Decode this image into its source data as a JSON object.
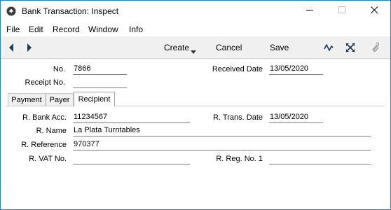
{
  "window": {
    "title": "Bank Transaction: Inspect"
  },
  "menu": {
    "items": [
      "File",
      "Edit",
      "Record",
      "Window",
      "Info"
    ]
  },
  "toolbar": {
    "create_label": "Create",
    "cancel_label": "Cancel",
    "save_label": "Save"
  },
  "header": {
    "no_label": "No.",
    "no_value": "7866",
    "received_date_label": "Received Date",
    "received_date_value": "13/05/2020",
    "receipt_no_label": "Receipt No.",
    "receipt_no_value": ""
  },
  "tabs": [
    {
      "label": "Payment",
      "active": false
    },
    {
      "label": "Payer",
      "active": false
    },
    {
      "label": "Recipient",
      "active": true
    }
  ],
  "recipient": {
    "bank_acc_label": "R. Bank Acc.",
    "bank_acc_value": "11234567",
    "trans_date_label": "R. Trans. Date",
    "trans_date_value": "13/05/2020",
    "name_label": "R. Name",
    "name_value": "La Plata Turntables",
    "reference_label": "R. Reference",
    "reference_value": "970377",
    "vat_no_label": "R. VAT No.",
    "vat_no_value": "",
    "reg_no_label": "R. Reg. No. 1",
    "reg_no_value": ""
  },
  "colors": {
    "window_border": "#1883d7",
    "active_tab_border": "#7aaee0",
    "icon_gray": "#555555"
  },
  "icons": [
    "app-icon",
    "minimize-icon",
    "maximize-icon",
    "close-icon",
    "prev-record-icon",
    "next-record-icon",
    "dropdown-arrow-icon",
    "graph-icon",
    "expand-icon",
    "attachment-icon"
  ]
}
